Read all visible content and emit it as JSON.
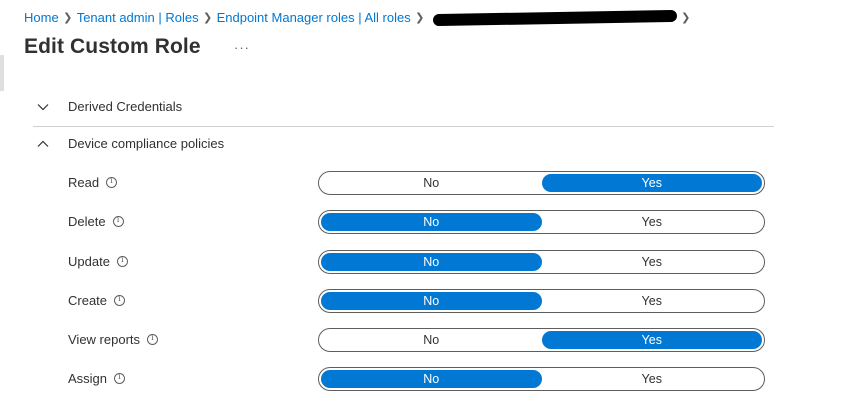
{
  "breadcrumb": {
    "items": [
      "Home",
      "Tenant admin | Roles",
      "Endpoint Manager roles | All roles"
    ]
  },
  "page": {
    "title": "Edit Custom Role",
    "more": "···"
  },
  "sections": {
    "derived": {
      "label": "Derived Credentials",
      "expanded": false
    },
    "compliance": {
      "label": "Device compliance policies",
      "expanded": true
    }
  },
  "toggle_options": {
    "no": "No",
    "yes": "Yes"
  },
  "permissions": [
    {
      "label": "Read",
      "value": "Yes"
    },
    {
      "label": "Delete",
      "value": "No"
    },
    {
      "label": "Update",
      "value": "No"
    },
    {
      "label": "Create",
      "value": "No"
    },
    {
      "label": "View reports",
      "value": "Yes"
    },
    {
      "label": "Assign",
      "value": "No"
    }
  ],
  "colors": {
    "accent": "#0078d4",
    "text": "#323130",
    "divider": "#d2d0ce"
  }
}
